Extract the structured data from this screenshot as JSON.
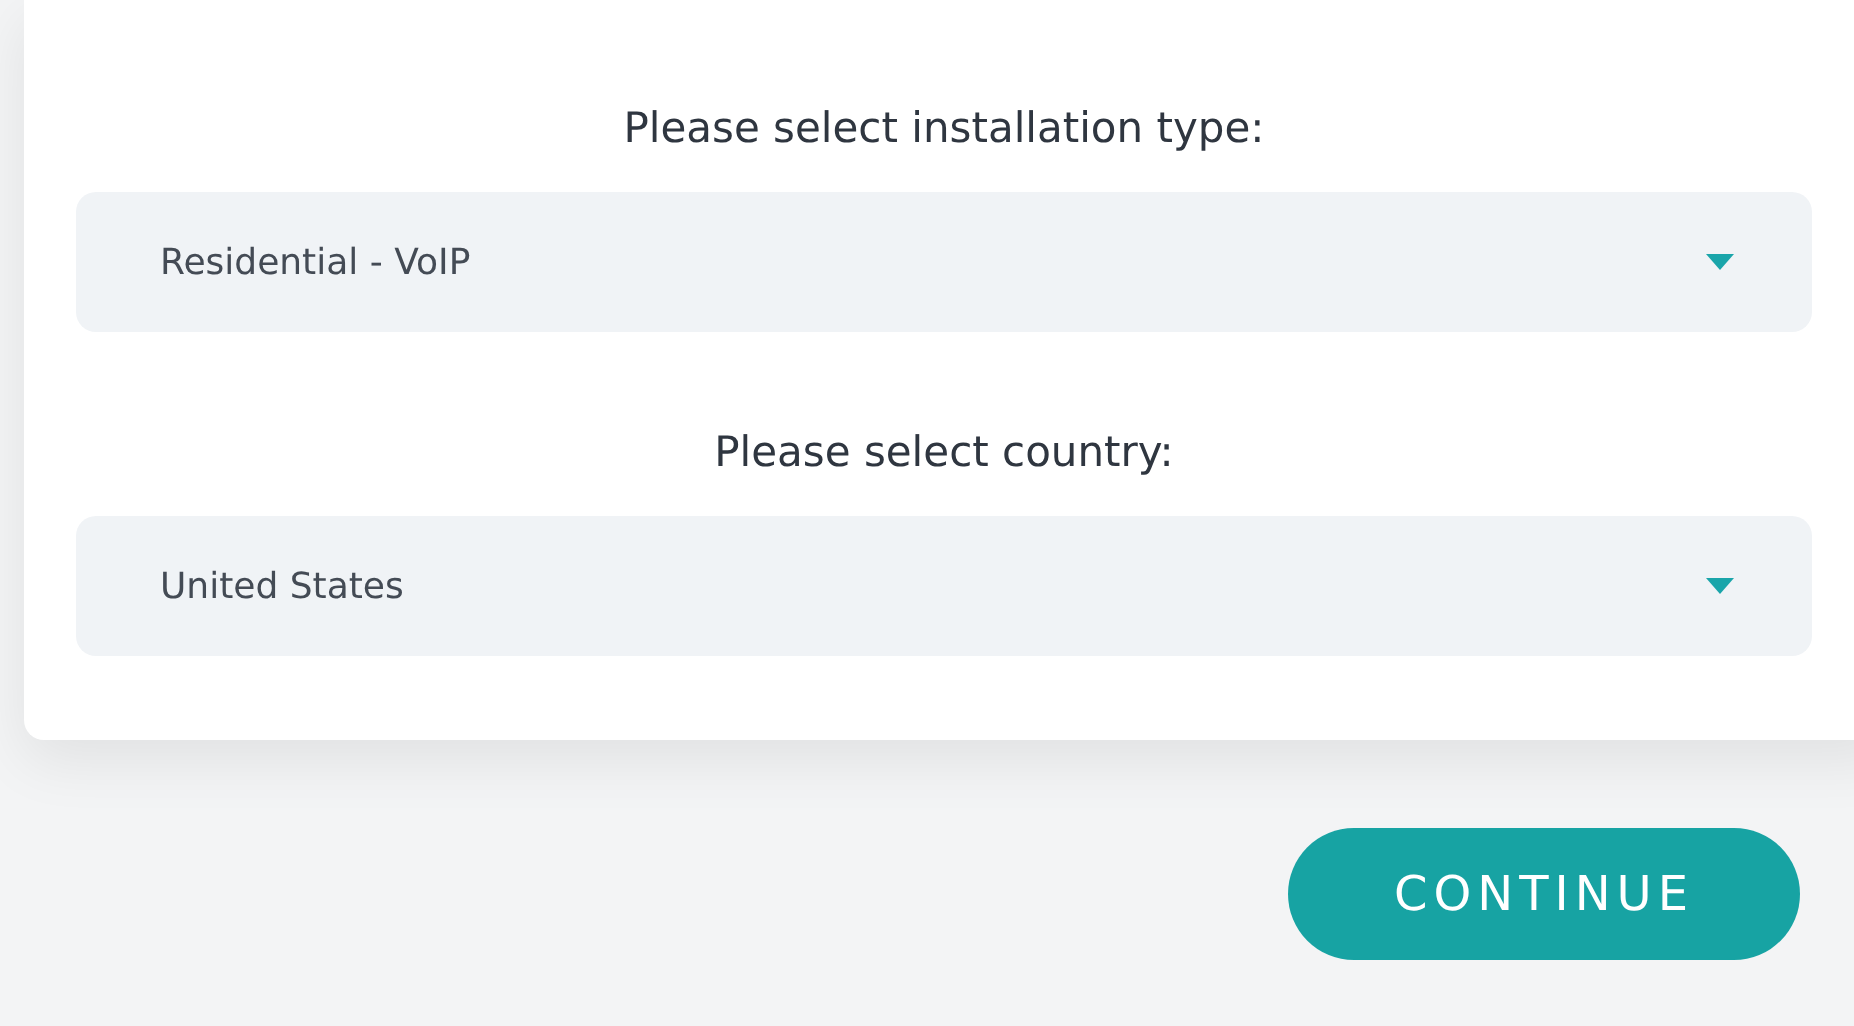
{
  "fields": [
    {
      "label": "Please select installation type:",
      "value": "Residential - VoIP"
    },
    {
      "label": "Please select country:",
      "value": "United States"
    }
  ],
  "button": {
    "label": "CONTINUE"
  }
}
